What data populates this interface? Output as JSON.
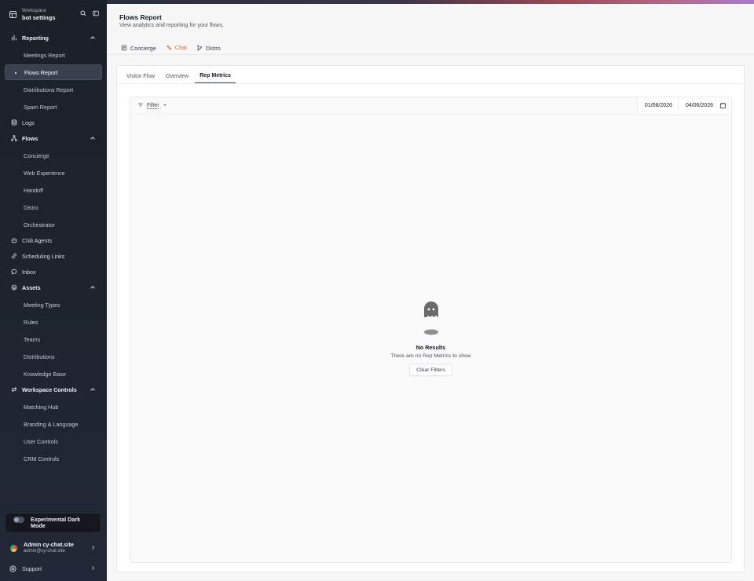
{
  "colors": {
    "accent": "#e4622b",
    "sidebar_bg": "#1e232d",
    "active_item_bg": "#3a4050",
    "page_bg": "#f7f7f7"
  },
  "workspace": {
    "label": "Workspace",
    "name": "bot settings"
  },
  "sidebar": {
    "reporting": {
      "label": "Reporting",
      "icon": "bar-chart-icon",
      "items": [
        "Meetings Report",
        "Flows Report",
        "Distributions Report",
        "Spam Report"
      ],
      "active": "Flows Report"
    },
    "logs": {
      "label": "Logs",
      "icon": "database-icon"
    },
    "flows": {
      "label": "Flows",
      "icon": "flow-icon",
      "items": [
        "Concierge",
        "Web Experience",
        "Handoff",
        "Distro",
        "Orchestrator"
      ]
    },
    "chili_agents": {
      "label": "Chili Agents",
      "icon": "agent-icon"
    },
    "scheduling_links": {
      "label": "Scheduling Links",
      "icon": "link-icon"
    },
    "inbox": {
      "label": "Inbox",
      "icon": "chat-icon"
    },
    "assets": {
      "label": "Assets",
      "icon": "layers-icon",
      "items": [
        "Meeting Types",
        "Rules",
        "Teams",
        "Distributions",
        "Knowledge Base"
      ]
    },
    "workspace_controls": {
      "label": "Workspace Controls",
      "icon": "arrows-icon",
      "items": [
        "Matching Hub",
        "Branding & Language",
        "User Controls",
        "CRM Controls"
      ]
    }
  },
  "dark_mode": {
    "label": "Experimental Dark Mode",
    "enabled": false
  },
  "user": {
    "name": "Admin cy-chat.site",
    "email": "admin@cy-chat.site"
  },
  "support": {
    "label": "Support"
  },
  "page": {
    "title": "Flows Report",
    "subtitle": "View analytics and reporting for your flows."
  },
  "flow_tabs": [
    {
      "label": "Concierge",
      "icon": "form-icon"
    },
    {
      "label": "Chat",
      "icon": "chat-tag-icon",
      "active": true
    },
    {
      "label": "Distro",
      "icon": "branch-icon"
    }
  ],
  "sub_tabs": [
    {
      "label": "Visitor Flow"
    },
    {
      "label": "Overview"
    },
    {
      "label": "Rep Metrics",
      "active": true
    }
  ],
  "filter": {
    "label": "Filter"
  },
  "date_range": {
    "start": "01/06/2026",
    "end": "04/06/2026"
  },
  "empty_state": {
    "icon": "ghost-icon",
    "title": "No Results",
    "message": "There are no Rep Metrics to show",
    "button": "Clear Filters"
  }
}
